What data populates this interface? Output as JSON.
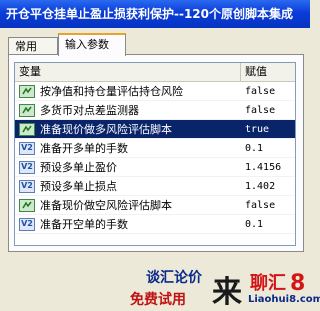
{
  "window": {
    "title": "开仓平仓挂单止盈止损获利保护--120个原创脚本集成"
  },
  "tabs": [
    {
      "label": "常用",
      "active": false
    },
    {
      "label": "输入参数",
      "active": true
    }
  ],
  "grid": {
    "columns": [
      "变量",
      "赋值"
    ],
    "rows": [
      {
        "name": "按净值和持仓量评估持仓风险",
        "value": "false",
        "type": "bool",
        "selected": false
      },
      {
        "name": "多货币对点差监测器",
        "value": "false",
        "type": "bool",
        "selected": false
      },
      {
        "name": "准备现价做多风险评估脚本",
        "value": "true",
        "type": "bool",
        "selected": true
      },
      {
        "name": "准备开多单的手数",
        "value": "0.1",
        "type": "double",
        "selected": false
      },
      {
        "name": "预设多单止盈价",
        "value": "1.4156",
        "type": "double",
        "selected": false
      },
      {
        "name": "预设多单止损点",
        "value": "1.402",
        "type": "double",
        "selected": false
      },
      {
        "name": "准备现价做空风险评估脚本",
        "value": "false",
        "type": "bool",
        "selected": false
      },
      {
        "name": "准备开空单的手数",
        "value": "0.1",
        "type": "double",
        "selected": false
      }
    ]
  },
  "icons": {
    "bool": "bool-param-icon",
    "double": "double-param-icon"
  },
  "colors": {
    "title_bar": "#0a3cd8",
    "selected_row": "#0a246a",
    "active_tab_accent": "#e8a42a"
  },
  "watermark": {
    "line1": "谈汇论价",
    "line2": "免费试用",
    "mark": "来",
    "brand": "聊汇",
    "digit": "8",
    "domain": "Liaohui8.com"
  }
}
